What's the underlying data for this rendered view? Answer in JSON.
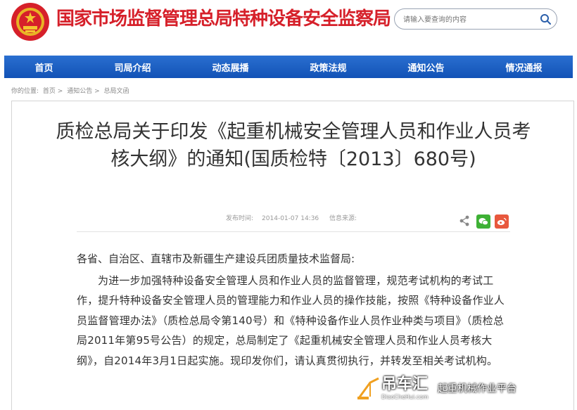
{
  "header": {
    "site_title": "国家市场监督管理总局特种设备安全监察局",
    "search_placeholder": "请输入要查询的内容"
  },
  "nav": {
    "items": [
      {
        "label": "首页"
      },
      {
        "label": "司局介绍"
      },
      {
        "label": "动态展播"
      },
      {
        "label": "政策法规"
      },
      {
        "label": "通知公告"
      },
      {
        "label": "情况通报"
      }
    ]
  },
  "breadcrumb": {
    "prefix": "你的位置:",
    "items": [
      "首页 >",
      "通知公告 >",
      "总局文函"
    ]
  },
  "article": {
    "title": "质检总局关于印发《起重机械安全管理人员和作业人员考核大纲》的通知(国质检特〔2013〕680号)",
    "publish_label": "发布时间:",
    "publish_time": "2014-01-07 14:36",
    "source_label": "信息来源:",
    "source_value": "",
    "salutation": "各省、自治区、直辖市及新疆生产建设兵团质量技术监督局:",
    "paragraph": "为进一步加强特种设备安全管理人员和作业人员的监督管理，规范考试机构的考试工作，提升特种设备安全管理人员的管理能力和作业人员的操作技能，按照《特种设备作业人员监督管理办法》（质检总局令第140号）和《特种设备作业人员作业种类与项目》（质检总局2011年第95号公告）的规定，总局制定了《起重机械安全管理人员和作业人员考核大纲》，自2014年3月1日起实施。现印发你们，请认真贯彻执行，并转发至相关考试机构。"
  },
  "share": {
    "icons": [
      "share-icon",
      "wechat-icon",
      "weibo-icon"
    ],
    "colors": {
      "wechat": "#3eb135",
      "weibo": "#e8583d"
    }
  },
  "watermark": {
    "brand": "吊车汇",
    "domain": "DiaoCheHui.com",
    "author": "起重机械作业平台"
  },
  "colors": {
    "title_red": "#d6202a",
    "nav_blue": "#1a5fc4",
    "text": "#333333"
  }
}
